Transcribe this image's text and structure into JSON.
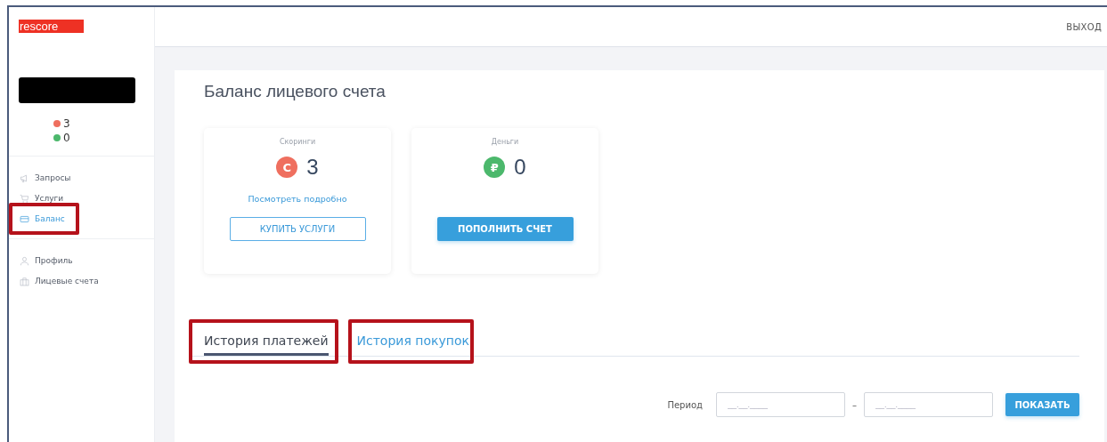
{
  "header": {
    "logout": "ВЫХОД"
  },
  "sidebar": {
    "logo": "rescore",
    "redacted": true,
    "balances": [
      {
        "kind": "scoring",
        "value": "3"
      },
      {
        "kind": "money",
        "value": "0"
      }
    ],
    "nav_groups": [
      [
        {
          "label": "Запросы",
          "selected": false,
          "annotated": false
        },
        {
          "label": "Услуги",
          "selected": false,
          "annotated": false
        },
        {
          "label": "Баланс",
          "selected": true,
          "annotated": true
        }
      ],
      [
        {
          "label": "Профиль",
          "selected": false,
          "annotated": false
        },
        {
          "label": "Лицевые счета",
          "selected": false,
          "annotated": false
        }
      ]
    ]
  },
  "page": {
    "title": "Баланс лицевого счета",
    "cards": [
      {
        "kind": "scoring",
        "caption": "Скоринги",
        "symbol": "С",
        "value": "3",
        "link": "Посмотреть подробно",
        "button": "КУПИТЬ УСЛУГИ"
      },
      {
        "kind": "money",
        "caption": "Деньги",
        "symbol": "₽",
        "value": "0",
        "button": "ПОПОЛНИТЬ СЧЕТ"
      }
    ],
    "tabs": [
      {
        "label": "История платежей",
        "selected": true,
        "annotated": true
      },
      {
        "label": "История покупок",
        "selected": false,
        "annotated": true
      }
    ],
    "filter": {
      "label": "Период",
      "from": {
        "placeholder": "__.__.____"
      },
      "separator": "–",
      "to": {
        "placeholder": "__.__.____"
      },
      "button": "ПОКАЗАТЬ"
    }
  }
}
